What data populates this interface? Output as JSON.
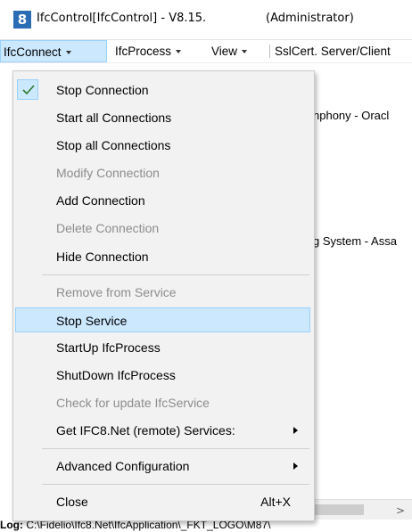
{
  "window": {
    "title": "IfcControl[IfcControl] - V8.15.",
    "admin": "(Administrator)"
  },
  "menubar": {
    "items": [
      {
        "label": "IfcConnect"
      },
      {
        "label": "IfcProcess"
      },
      {
        "label": "View"
      },
      {
        "label": "SslCert. Server/Client"
      }
    ]
  },
  "background": {
    "line1": "nphony - Oracl",
    "line2": "g System - Assa",
    "log_label": "Log:",
    "log_path": "C:\\Fidelio\\Ifc8.Net\\IfcApplication\\_FKT_LOGO\\M87\\"
  },
  "menu": {
    "stop_connection": "Stop Connection",
    "start_all": "Start all Connections",
    "stop_all": "Stop all Connections",
    "modify": "Modify Connection",
    "add": "Add Connection",
    "delete": "Delete Connection",
    "hide": "Hide Connection",
    "remove_service": "Remove from Service",
    "stop_service": "Stop Service",
    "startup": "StartUp IfcProcess",
    "shutdown": "ShutDown IfcProcess",
    "check_update": "Check for update IfcService",
    "get_services": "Get IFC8.Net (remote) Services:",
    "advanced": "Advanced Configuration",
    "close": "Close",
    "close_shortcut": "Alt+X"
  },
  "colors": {
    "highlight": "#cce8ff",
    "highlight_border": "#99d1ff",
    "check": "#2a7a2a",
    "disabled_text": "#8d8d8d"
  }
}
